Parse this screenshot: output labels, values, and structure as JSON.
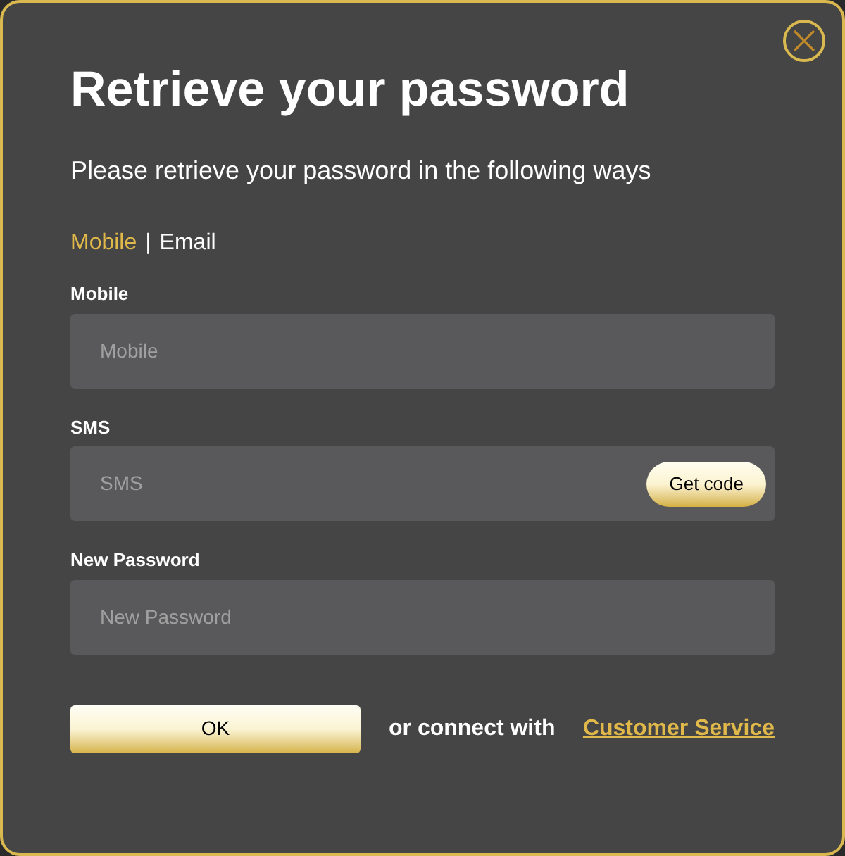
{
  "title": "Retrieve your password",
  "subtitle": "Please retrieve your password in the following ways",
  "tabs": [
    {
      "label": "Mobile",
      "selected": true
    },
    {
      "label": "Email",
      "selected": false
    }
  ],
  "tab_separator": "|",
  "fields": [
    {
      "kind": "plain",
      "label": "Mobile",
      "placeholder": "Mobile"
    },
    {
      "kind": "code",
      "label": "SMS",
      "placeholder": "SMS",
      "button": "Get code"
    },
    {
      "kind": "plain",
      "label": "New Password",
      "placeholder": "New Password"
    }
  ],
  "ok_button": "OK",
  "connect_text": "or connect with",
  "service_link": "Customer Service"
}
